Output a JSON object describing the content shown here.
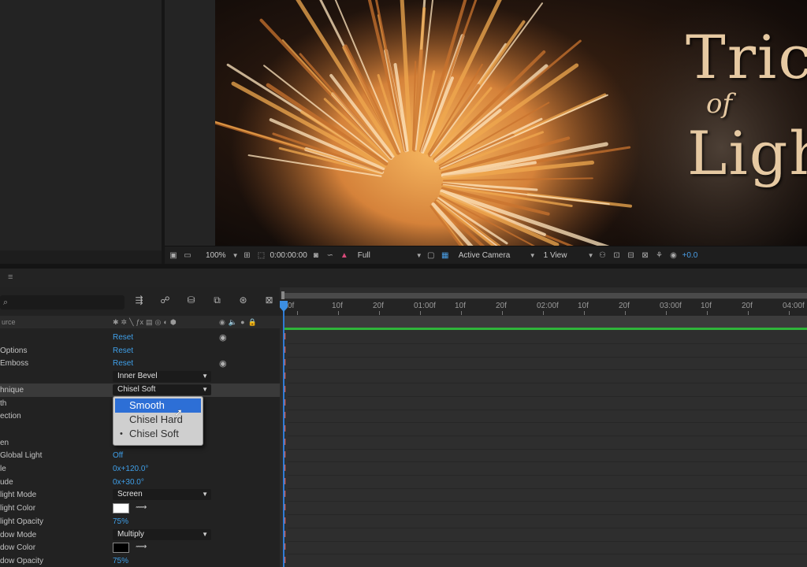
{
  "comp_title": {
    "line1": "Tric",
    "of": "of",
    "line2": "Ligh"
  },
  "viewer_bar": {
    "zoom": "100%",
    "timecode": "0:00:00:00",
    "resolution": "Full",
    "camera": "Active Camera",
    "views": "1 View",
    "exposure": "+0.0"
  },
  "timeline": {
    "menu_icon": "≡",
    "column_name": "urce",
    "ruler_labels": [
      "0f",
      "10f",
      "20f",
      "01:00f",
      "10f",
      "20f",
      "02:00f",
      "10f",
      "20f",
      "03:00f",
      "10f",
      "20f",
      "04:00f"
    ]
  },
  "properties": [
    {
      "label": "",
      "value": "Reset",
      "kind": "link"
    },
    {
      "label": "Options",
      "value": "Reset",
      "kind": "link"
    },
    {
      "label": "Emboss",
      "value": "Reset",
      "kind": "link"
    },
    {
      "label": "",
      "value": "Inner Bevel",
      "kind": "dropdown"
    },
    {
      "label": "hnique",
      "value": "Chisel Soft",
      "kind": "dropdown"
    },
    {
      "label": "th",
      "value": "",
      "kind": "plain"
    },
    {
      "label": "ection",
      "value": "",
      "kind": "plain"
    },
    {
      "label": "",
      "value": "",
      "kind": "plain"
    },
    {
      "label": "en",
      "value": "",
      "kind": "plain"
    },
    {
      "label": "Global Light",
      "value": "Off",
      "kind": "link"
    },
    {
      "label": "le",
      "value": "0x+120.0°",
      "kind": "link"
    },
    {
      "label": "ude",
      "value": "0x+30.0°",
      "kind": "link"
    },
    {
      "label": "light Mode",
      "value": "Screen",
      "kind": "dropdown"
    },
    {
      "label": "light Color",
      "value": "",
      "kind": "color",
      "color": "#ffffff"
    },
    {
      "label": "light Opacity",
      "value": "75%",
      "kind": "link"
    },
    {
      "label": "dow Mode",
      "value": "Multiply",
      "kind": "dropdown"
    },
    {
      "label": "dow Color",
      "value": "",
      "kind": "color",
      "color": "#000000"
    },
    {
      "label": "dow Opacity",
      "value": "75%",
      "kind": "link"
    }
  ],
  "technique_menu": {
    "options": [
      "Smooth",
      "Chisel Hard",
      "Chisel Soft"
    ],
    "highlighted": "Smooth",
    "checked": "Chisel Soft"
  },
  "colors": {
    "accent": "#3f9fe8",
    "selection": "#2d6fd6",
    "work_bar": "#2fb53a",
    "keyframe": "#e36c6c"
  }
}
